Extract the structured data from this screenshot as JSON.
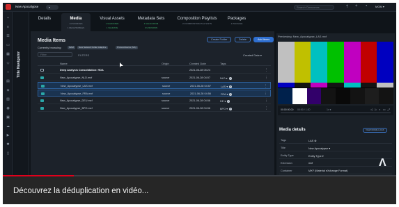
{
  "header": {
    "app_title": "New Apocalypse",
    "search_placeholder": "Search Ownzones",
    "user_label": "MGM ▾"
  },
  "title_navigator": {
    "label": "Title Navigator"
  },
  "tabs": [
    {
      "label": "Details",
      "sub": ""
    },
    {
      "label": "Media",
      "sub": "14 SOURCES",
      "sub2": "1 DEJAVIRABLES"
    },
    {
      "label": "Visual Assets",
      "sub": "1 VALIDATED",
      "sub2": "1 VALIDATE"
    },
    {
      "label": "Metadata Sets",
      "sub": "4 VALID FROM",
      "sub2": "0 UNKNOWN"
    },
    {
      "label": "Composition Playlists",
      "sub": "21 COMPOSITION PLAYLISTS"
    },
    {
      "label": "Packages",
      "sub": "1 PACKAGE"
    }
  ],
  "media_items": {
    "title": "Media Items",
    "buttons": {
      "create_folder": "Create Folder",
      "delete": "Delete",
      "add_items": "Add Items"
    },
    "browsing_label": "Currently browsing:",
    "chips": [
      "MAM",
      "New Network Folder Adaptive",
      "ProcessSource (MA)"
    ],
    "filter_placeholder": "Filter",
    "filters_label": "FILTERS",
    "sort_label": "Created Date ▾",
    "columns": [
      "Name",
      "Origin",
      "Created Date",
      "Tags"
    ],
    "rows": [
      {
        "name": "Deep Analysis Consolidation: HDA",
        "origin": "",
        "date": "2021-06-28 05:24",
        "tag": "",
        "folder": true,
        "bold": true
      },
      {
        "name": "New_Apocalypse_NLD.mxf",
        "origin": "source",
        "date": "2021-06-28 04:57",
        "tag": "NLD",
        "folder": false
      },
      {
        "name": "New_Apocalypse_LAS.mxf",
        "origin": "source",
        "date": "2021-06-28 04:57",
        "tag": "LAS",
        "folder": false,
        "selected": true
      },
      {
        "name": "New_Apocalypse_FRA.mxf",
        "origin": "source",
        "date": "2021-06-28 04:56",
        "tag": "FRA",
        "folder": false,
        "selected": true
      },
      {
        "name": "New_Apocalypse_DEU.mxf",
        "origin": "source",
        "date": "2021-06-28 04:56",
        "tag": "DE",
        "folder": false
      },
      {
        "name": "New_Apocalypse_BPO.mxf",
        "origin": "source",
        "date": "2021-06-28 04:56",
        "tag": "BPO",
        "folder": false
      }
    ]
  },
  "preview": {
    "label": "Previewing: New_Apocalypse_LAS.mxf",
    "player_label": "00:00:00:00",
    "time": "00:00 / 1:20",
    "rate": "1x  ▾",
    "colors_top": [
      "#c0c0c0",
      "#c0c000",
      "#00c0c0",
      "#00c000",
      "#c000c0",
      "#c00000",
      "#0000c0"
    ],
    "colors_mid": [
      "#0000c0",
      "#131313",
      "#c000c0",
      "#131313",
      "#00c0c0",
      "#131313",
      "#c0c0c0"
    ],
    "colors_bottom": [
      "#00214c",
      "#ffffff",
      "#32006a",
      "#131313",
      "#090909",
      "#131313",
      "#1d1d1d",
      "#131313"
    ]
  },
  "media_details": {
    "title": "Media details",
    "view_button": "VIEW MORE LOGS",
    "rows": [
      {
        "key": "Tags",
        "value": "LAS  ⊗"
      },
      {
        "key": "Title",
        "value": "New Apocalypse  ▾"
      },
      {
        "key": "Entity Type",
        "value": "Entity Type  ▾"
      },
      {
        "key": "Extension",
        "value": "mxf"
      },
      {
        "key": "Container",
        "value": "MXF (Material eXchange Format)"
      }
    ]
  },
  "video": {
    "caption": "Découvrez la déduplication en vidéo...",
    "progress": 0.18,
    "accent": "#e0001b"
  }
}
